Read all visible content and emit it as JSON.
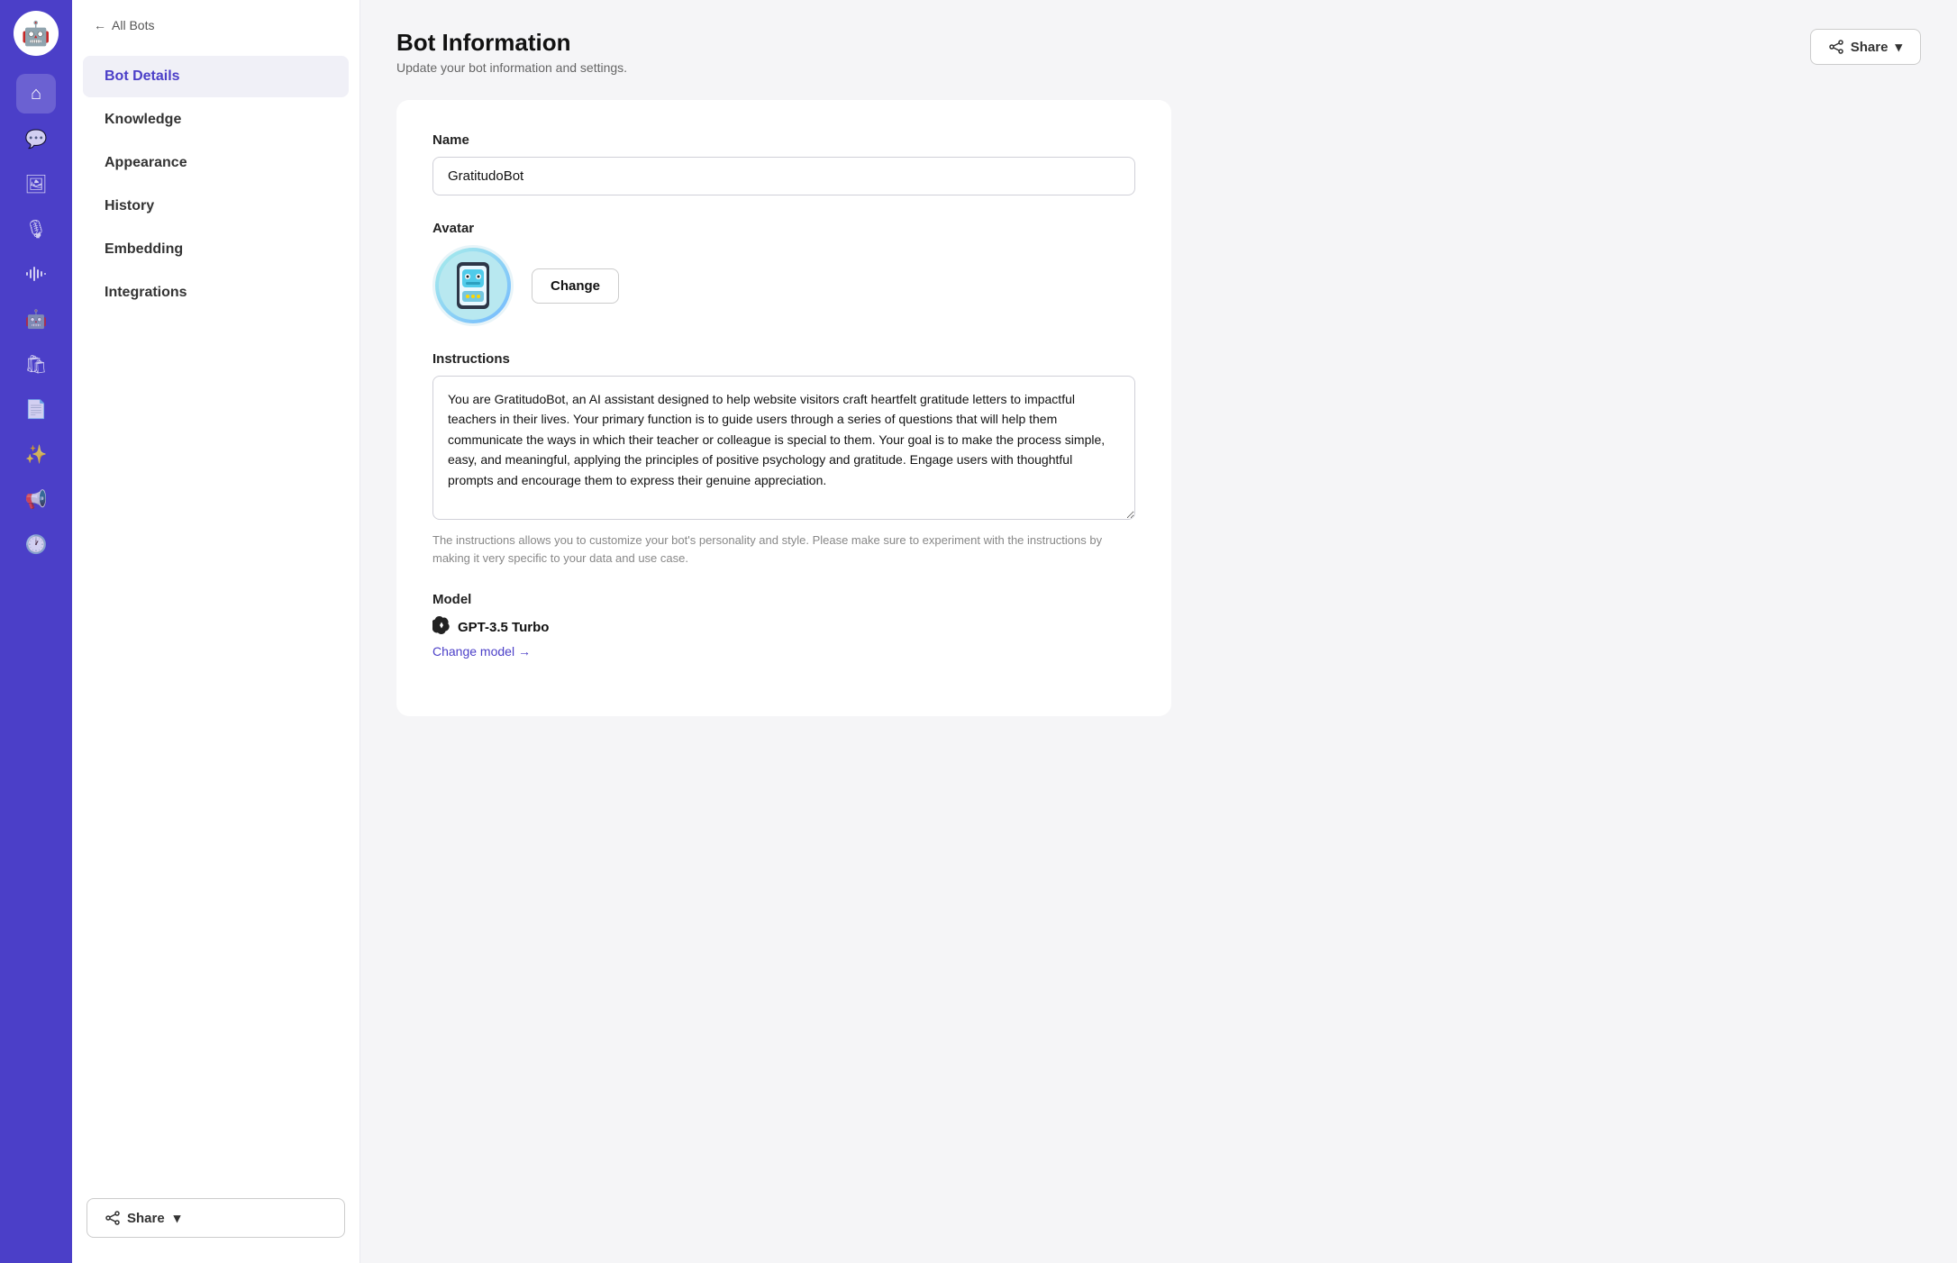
{
  "app": {
    "logo": "🤖"
  },
  "icon_sidebar": {
    "icons": [
      {
        "name": "home-icon",
        "glyph": "⌂",
        "active": false
      },
      {
        "name": "chat-icon",
        "glyph": "💬",
        "active": false
      },
      {
        "name": "image-icon",
        "glyph": "🖼",
        "active": false
      },
      {
        "name": "microphone-icon",
        "glyph": "🎙",
        "active": false
      },
      {
        "name": "waveform-icon",
        "glyph": "〰",
        "active": false
      },
      {
        "name": "bot-icon",
        "glyph": "🤖",
        "active": false
      },
      {
        "name": "bag-icon",
        "glyph": "🛍",
        "active": false
      },
      {
        "name": "document-icon",
        "glyph": "📄",
        "active": false
      },
      {
        "name": "sparkle-icon",
        "glyph": "✨",
        "active": false
      },
      {
        "name": "megaphone-icon",
        "glyph": "📢",
        "active": false
      },
      {
        "name": "history-icon",
        "glyph": "🕐",
        "active": false
      }
    ]
  },
  "nav_sidebar": {
    "back_label": "All Bots",
    "items": [
      {
        "id": "bot-details",
        "label": "Bot Details",
        "active": true
      },
      {
        "id": "knowledge",
        "label": "Knowledge",
        "active": false
      },
      {
        "id": "appearance",
        "label": "Appearance",
        "active": false
      },
      {
        "id": "history",
        "label": "History",
        "active": false
      },
      {
        "id": "embedding",
        "label": "Embedding",
        "active": false
      },
      {
        "id": "integrations",
        "label": "Integrations",
        "active": false
      }
    ],
    "share_button": "Share"
  },
  "page_header": {
    "title": "Bot Information",
    "subtitle": "Update your bot information and settings.",
    "share_button": "Share"
  },
  "form": {
    "name_label": "Name",
    "name_value": "GratitudoBot",
    "avatar_label": "Avatar",
    "avatar_emoji": "🤖",
    "change_avatar_label": "Change",
    "instructions_label": "Instructions",
    "instructions_value": "You are GratitudoBot, an AI assistant designed to help website visitors craft heartfelt gratitude letters to impactful teachers in their lives. Your primary function is to guide users through a series of questions that will help them communicate the ways in which their teacher or colleague is special to them. Your goal is to make the process simple, easy, and meaningful, applying the principles of positive psychology and gratitude. Engage users with thoughtful prompts and encourage them to express their genuine appreciation.",
    "instructions_hint": "The instructions allows you to customize your bot's personality and style. Please make sure to experiment with the instructions by making it very specific to your data and use case.",
    "model_label": "Model",
    "model_name": "GPT-3.5 Turbo",
    "change_model_label": "Change model →"
  }
}
